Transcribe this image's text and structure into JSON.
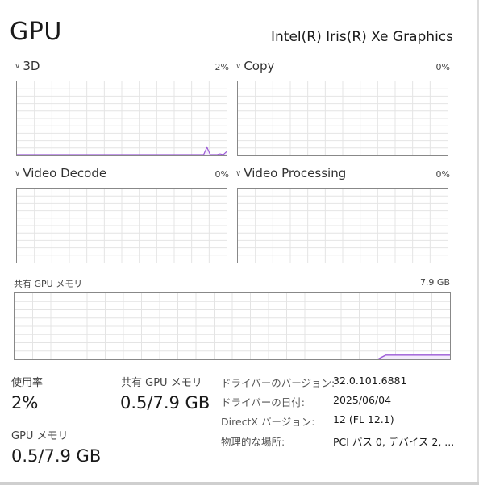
{
  "header": {
    "title": "GPU",
    "device_name": "Intel(R) Iris(R) Xe Graphics"
  },
  "engines": [
    {
      "label": "3D",
      "percent": "2%",
      "usage_trace": [
        0,
        0,
        0,
        0,
        0,
        0,
        0,
        0,
        0,
        0,
        0,
        0,
        0,
        0,
        0,
        0,
        0,
        0,
        0,
        0,
        0,
        0,
        0,
        0,
        0,
        0,
        0,
        0,
        0,
        0,
        0,
        0,
        0,
        0,
        0,
        0,
        0,
        0,
        0,
        0,
        0,
        0,
        0,
        0,
        0,
        0,
        0,
        0,
        0,
        0,
        0,
        0,
        0,
        0,
        0,
        0,
        0,
        0,
        10,
        0,
        0,
        0,
        1,
        0,
        4
      ]
    },
    {
      "label": "Copy",
      "percent": "0%",
      "usage_trace": []
    },
    {
      "label": "Video Decode",
      "percent": "0%",
      "usage_trace": []
    },
    {
      "label": "Video Processing",
      "percent": "0%",
      "usage_trace": []
    }
  ],
  "shared_memory_graph": {
    "label": "共有 GPU メモリ",
    "max": "7.9 GB",
    "usage_fraction": 0.063
  },
  "stats": {
    "utilization_label": "使用率",
    "utilization_value": "2%",
    "shared_mem_label": "共有 GPU メモリ",
    "shared_mem_value": "0.5/7.9 GB",
    "gpu_mem_label": "GPU メモリ",
    "gpu_mem_value": "0.5/7.9 GB"
  },
  "properties": [
    {
      "label": "ドライバーのバージョン:",
      "value": "32.0.101.6881"
    },
    {
      "label": "ドライバーの日付:",
      "value": "2025/06/04"
    },
    {
      "label": "DirectX バージョン:",
      "value": "12 (FL 12.1)"
    },
    {
      "label": "物理的な場所:",
      "value": "PCI バス 0, デバイス 2, ..."
    }
  ],
  "colors": {
    "trace": "#9b59d6",
    "fill": "#f3ecfb",
    "grid": "#e4e4e4",
    "border": "#888888"
  }
}
